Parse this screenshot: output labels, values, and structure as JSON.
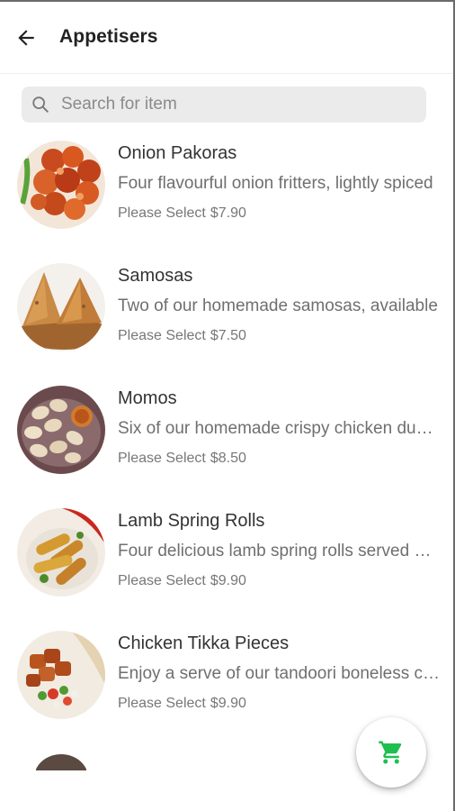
{
  "header": {
    "title": "Appetisers",
    "back_icon": "arrow-left-icon"
  },
  "search": {
    "placeholder": "Search for item",
    "value": "",
    "icon": "search-icon"
  },
  "items": [
    {
      "name": "Onion Pakoras",
      "description": "Four flavourful onion fritters, lightly spiced",
      "select_label": "Please Select",
      "price": "$7.90"
    },
    {
      "name": "Samosas",
      "description": "Two of our homemade samosas, available",
      "select_label": "Please Select",
      "price": "$7.50"
    },
    {
      "name": "Momos",
      "description": "Six of our homemade crispy chicken dumplings",
      "select_label": "Please Select",
      "price": "$8.50"
    },
    {
      "name": "Lamb Spring Rolls",
      "description": "Four delicious lamb spring rolls served with",
      "select_label": "Please Select",
      "price": "$9.90"
    },
    {
      "name": "Chicken Tikka Pieces",
      "description": "Enjoy a serve of our tandoori boneless chicken",
      "select_label": "Please Select",
      "price": "$9.90"
    }
  ],
  "cart": {
    "icon": "shopping-cart-icon",
    "accent_color": "#1fbf4f"
  }
}
